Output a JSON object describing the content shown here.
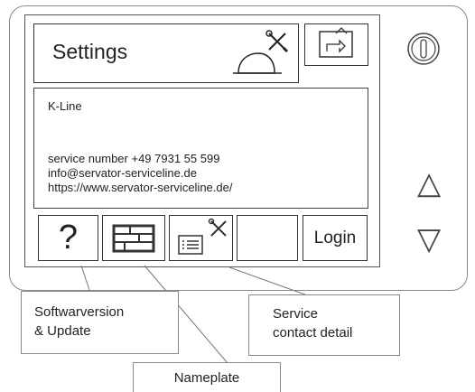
{
  "header": {
    "title": "Settings"
  },
  "contact": {
    "company": "K-Line",
    "service_number": "service number +49 7931 55 599",
    "email": "info@servator-serviceline.de",
    "website": "https://www.servator-serviceline.de/"
  },
  "buttons": {
    "help_label": "?",
    "login_label": "Login"
  },
  "callouts": {
    "softwarversion": [
      "Softwarversion",
      "& Update"
    ],
    "service_contact": [
      "Service",
      "contact detail"
    ],
    "nameplate": "Nameplate"
  },
  "side_controls": {
    "up_arrow": "△",
    "down_arrow": "▽"
  }
}
